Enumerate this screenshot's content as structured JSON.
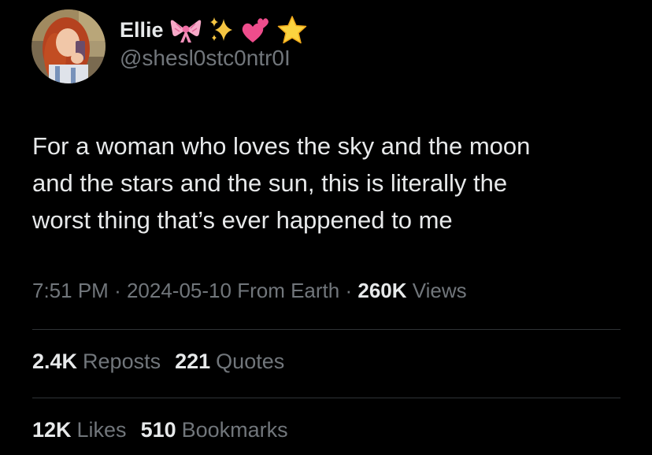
{
  "author": {
    "display_name": "Ellie",
    "emojis": [
      "bow-icon",
      "sparkles-icon",
      "two-hearts-icon",
      "star-icon"
    ],
    "handle": "@shesl0stc0ntr0I"
  },
  "tweet": {
    "lines": [
      "For a woman who loves the sky and the moon",
      "and the stars and the sun, this is literally the",
      "worst thing that’s ever happened to me"
    ]
  },
  "meta": {
    "time": "7:51 PM",
    "sep1": "·",
    "date": "2024-05-10",
    "source": "From Earth",
    "sep2": "·",
    "views_count": "260K",
    "views_label": "Views"
  },
  "engagement": {
    "reposts_count": "2.4K",
    "reposts_label": "Reposts",
    "quotes_count": "221",
    "quotes_label": "Quotes",
    "likes_count": "12K",
    "likes_label": "Likes",
    "bookmarks_count": "510",
    "bookmarks_label": "Bookmarks"
  },
  "colors": {
    "background": "#000000",
    "primary_text": "#e7e9ea",
    "secondary_text": "#71767b",
    "divider": "#2f3336"
  }
}
